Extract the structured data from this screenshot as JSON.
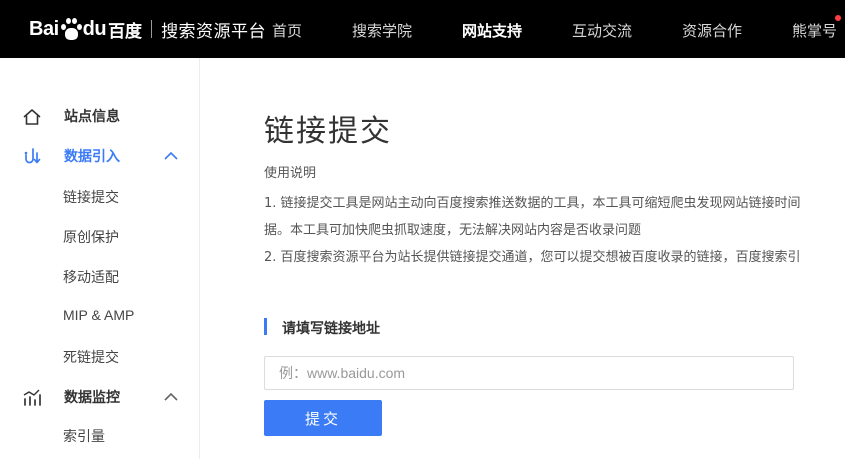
{
  "header": {
    "logo": {
      "bai": "Bai",
      "du": "du",
      "cn": "百度",
      "platform": "搜索资源平台",
      "icon": "paw-icon"
    },
    "nav": [
      {
        "label": "首页"
      },
      {
        "label": "搜索学院"
      },
      {
        "label": "网站支持",
        "active": true
      },
      {
        "label": "互动交流"
      },
      {
        "label": "资源合作"
      },
      {
        "label": "熊掌号"
      }
    ]
  },
  "sidebar": {
    "groups": [
      {
        "label": "站点信息",
        "icon": "home-icon"
      },
      {
        "label": "数据引入",
        "icon": "data-import-icon",
        "expanded": true,
        "items": [
          {
            "label": "链接提交"
          },
          {
            "label": "原创保护"
          },
          {
            "label": "移动适配"
          },
          {
            "label": "MIP & AMP"
          },
          {
            "label": "死链提交"
          }
        ]
      },
      {
        "label": "数据监控",
        "icon": "chart-icon",
        "expanded": true,
        "items": [
          {
            "label": "索引量"
          }
        ]
      }
    ]
  },
  "main": {
    "title": "链接提交",
    "usage_heading": "使用说明",
    "usage_lines": [
      "1. 链接提交工具是网站主动向百度搜索推送数据的工具，本工具可缩短爬虫发现网站链接时间",
      "据。本工具可加快爬虫抓取速度，无法解决网站内容是否收录问题",
      "2. 百度搜索资源平台为站长提供链接提交通道，您可以提交想被百度收录的链接，百度搜索引"
    ],
    "section_title": "请填写链接地址",
    "url_input": {
      "value": "",
      "placeholder": "例：www.baidu.com"
    },
    "submit_label": "提交"
  },
  "colors": {
    "accent": "#3b7cf6",
    "topbar": "#000000",
    "notify_dot": "#ff4040"
  }
}
